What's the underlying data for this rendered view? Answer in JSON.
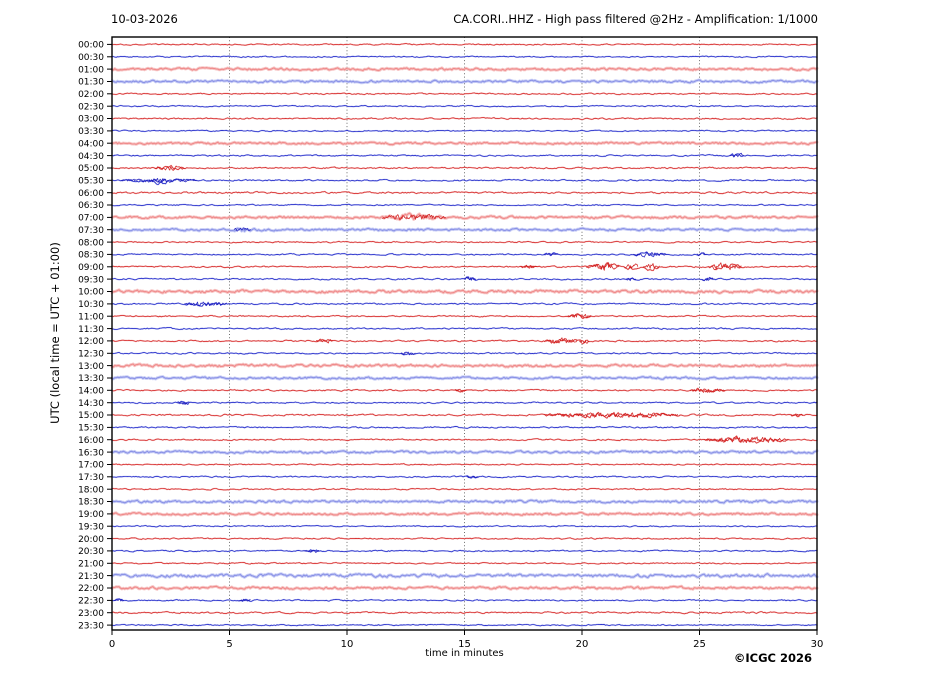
{
  "chart_data": {
    "type": "line",
    "subtype": "helicorder-seismogram-dayplot",
    "title_left": "10-03-2026",
    "title_right": "CA.CORI..HHZ - High pass filtered @2Hz - Amplification: 1/1000",
    "station": "CA.CORI..HHZ",
    "filter": "High pass filtered @2Hz",
    "amplification": "1/1000",
    "date": "10-03-2026",
    "xlabel": "time in minutes",
    "ylabel": "UTC (local time = UTC + 01:00)",
    "copyright": "©ICGC 2026",
    "x_range": [
      0,
      30
    ],
    "x_ticks": [
      0,
      5,
      10,
      15,
      20,
      25,
      30
    ],
    "gridline_minutes": [
      5,
      10,
      15,
      20,
      25
    ],
    "minutes_per_line": 30,
    "grid_on": true,
    "colors": {
      "red_center": "#d83232",
      "red_halo": "#f2b0b0",
      "red_light_center": "#ef8a8a",
      "red_light_halo": "#f6bcbc",
      "red_event": "#cf1616",
      "blue_center": "#2a32cc",
      "blue_halo": "#b0b6f0",
      "blue_light_center": "#8a92e6",
      "blue_light_halo": "#c0c6f4",
      "blue_event": "#1616bb",
      "grid": "#4a4a4a",
      "frame": "#000000"
    },
    "rows": [
      {
        "t": "00:00",
        "c": "red",
        "amp": 0.5,
        "light": false,
        "events": []
      },
      {
        "t": "00:30",
        "c": "blue",
        "amp": 0.5,
        "light": false,
        "events": []
      },
      {
        "t": "01:00",
        "c": "red",
        "amp": 0.9,
        "light": true,
        "events": []
      },
      {
        "t": "01:30",
        "c": "blue",
        "amp": 0.9,
        "light": true,
        "events": []
      },
      {
        "t": "02:00",
        "c": "red",
        "amp": 0.55,
        "light": false,
        "events": []
      },
      {
        "t": "02:30",
        "c": "blue",
        "amp": 0.5,
        "light": false,
        "events": []
      },
      {
        "t": "03:00",
        "c": "red",
        "amp": 0.6,
        "light": false,
        "events": []
      },
      {
        "t": "03:30",
        "c": "blue",
        "amp": 0.5,
        "light": false,
        "events": []
      },
      {
        "t": "04:00",
        "c": "red",
        "amp": 0.85,
        "light": true,
        "events": []
      },
      {
        "t": "04:30",
        "c": "blue",
        "amp": 0.55,
        "light": false,
        "events": [
          [
            26.3,
            26.9,
            1.4
          ]
        ]
      },
      {
        "t": "05:00",
        "c": "red",
        "amp": 0.6,
        "light": false,
        "events": [
          [
            1.8,
            3.1,
            1.2
          ]
        ]
      },
      {
        "t": "05:30",
        "c": "blue",
        "amp": 0.6,
        "light": false,
        "events": [
          [
            0.4,
            3.6,
            1.0
          ],
          [
            1.7,
            2.3,
            1.6
          ]
        ]
      },
      {
        "t": "06:00",
        "c": "red",
        "amp": 0.7,
        "light": false,
        "events": []
      },
      {
        "t": "06:30",
        "c": "blue",
        "amp": 0.5,
        "light": false,
        "events": []
      },
      {
        "t": "07:00",
        "c": "red",
        "amp": 0.9,
        "light": true,
        "events": [
          [
            11.5,
            14.2,
            1.6
          ]
        ]
      },
      {
        "t": "07:30",
        "c": "blue",
        "amp": 0.85,
        "light": true,
        "events": [
          [
            5.2,
            5.9,
            1.1
          ]
        ]
      },
      {
        "t": "08:00",
        "c": "red",
        "amp": 0.55,
        "light": false,
        "events": []
      },
      {
        "t": "08:30",
        "c": "blue",
        "amp": 0.55,
        "light": false,
        "events": [
          [
            18.4,
            19.0,
            0.9
          ],
          [
            22.2,
            23.6,
            1.4
          ],
          [
            24.9,
            25.3,
            0.9
          ]
        ]
      },
      {
        "t": "09:00",
        "c": "red",
        "amp": 0.6,
        "light": false,
        "events": [
          [
            17.4,
            18.1,
            0.9
          ],
          [
            20.2,
            21.6,
            2.2
          ],
          [
            21.8,
            22.4,
            2.0
          ],
          [
            22.6,
            23.3,
            2.2
          ],
          [
            25.4,
            26.8,
            2.2
          ]
        ]
      },
      {
        "t": "09:30",
        "c": "blue",
        "amp": 0.6,
        "light": false,
        "events": [
          [
            15.0,
            15.5,
            1.7
          ],
          [
            21.9,
            22.3,
            0.9
          ],
          [
            25.1,
            25.6,
            1.1
          ]
        ]
      },
      {
        "t": "10:00",
        "c": "red",
        "amp": 1.1,
        "light": true,
        "events": []
      },
      {
        "t": "10:30",
        "c": "blue",
        "amp": 0.6,
        "light": false,
        "events": [
          [
            3.1,
            4.9,
            1.4
          ]
        ]
      },
      {
        "t": "11:00",
        "c": "red",
        "amp": 0.55,
        "light": false,
        "events": [
          [
            19.4,
            20.4,
            1.4
          ]
        ]
      },
      {
        "t": "11:30",
        "c": "blue",
        "amp": 0.6,
        "light": false,
        "events": []
      },
      {
        "t": "12:00",
        "c": "red",
        "amp": 0.6,
        "light": false,
        "events": [
          [
            8.7,
            9.4,
            1.4
          ],
          [
            18.4,
            19.8,
            1.6
          ],
          [
            19.9,
            20.3,
            2.4
          ]
        ]
      },
      {
        "t": "12:30",
        "c": "blue",
        "amp": 0.55,
        "light": false,
        "events": [
          [
            12.3,
            12.9,
            1.1
          ]
        ]
      },
      {
        "t": "13:00",
        "c": "red",
        "amp": 1.0,
        "light": true,
        "events": []
      },
      {
        "t": "13:30",
        "c": "blue",
        "amp": 0.8,
        "light": true,
        "events": []
      },
      {
        "t": "14:00",
        "c": "red",
        "amp": 0.6,
        "light": false,
        "events": [
          [
            14.6,
            15.1,
            1.1
          ],
          [
            24.6,
            26.1,
            1.2
          ]
        ]
      },
      {
        "t": "14:30",
        "c": "blue",
        "amp": 0.55,
        "light": false,
        "events": [
          [
            2.8,
            3.3,
            1.4
          ]
        ]
      },
      {
        "t": "15:00",
        "c": "red",
        "amp": 0.65,
        "light": false,
        "events": [
          [
            18.4,
            24.1,
            1.5
          ],
          [
            28.9,
            29.4,
            1.2
          ]
        ]
      },
      {
        "t": "15:30",
        "c": "blue",
        "amp": 0.6,
        "light": false,
        "events": []
      },
      {
        "t": "16:00",
        "c": "red",
        "amp": 0.6,
        "light": false,
        "events": [
          [
            25.2,
            28.8,
            2.0
          ]
        ]
      },
      {
        "t": "16:30",
        "c": "blue",
        "amp": 0.9,
        "light": true,
        "events": []
      },
      {
        "t": "17:00",
        "c": "red",
        "amp": 0.5,
        "light": false,
        "events": []
      },
      {
        "t": "17:30",
        "c": "blue",
        "amp": 0.55,
        "light": false,
        "events": [
          [
            15.1,
            15.6,
            0.9
          ]
        ]
      },
      {
        "t": "18:00",
        "c": "red",
        "amp": 0.55,
        "light": false,
        "events": []
      },
      {
        "t": "18:30",
        "c": "blue",
        "amp": 1.0,
        "light": true,
        "events": []
      },
      {
        "t": "19:00",
        "c": "red",
        "amp": 0.85,
        "light": true,
        "events": []
      },
      {
        "t": "19:30",
        "c": "blue",
        "amp": 0.5,
        "light": false,
        "events": []
      },
      {
        "t": "20:00",
        "c": "red",
        "amp": 0.55,
        "light": false,
        "events": []
      },
      {
        "t": "20:30",
        "c": "blue",
        "amp": 0.55,
        "light": false,
        "events": [
          [
            8.2,
            8.8,
            1.1
          ]
        ]
      },
      {
        "t": "21:00",
        "c": "red",
        "amp": 0.5,
        "light": false,
        "events": []
      },
      {
        "t": "21:30",
        "c": "blue",
        "amp": 1.2,
        "light": true,
        "events": []
      },
      {
        "t": "22:00",
        "c": "red",
        "amp": 0.95,
        "light": true,
        "events": []
      },
      {
        "t": "22:30",
        "c": "blue",
        "amp": 0.55,
        "light": false,
        "events": [
          [
            0.1,
            0.5,
            0.9
          ],
          [
            5.4,
            5.9,
            0.8
          ]
        ]
      },
      {
        "t": "23:00",
        "c": "red",
        "amp": 0.65,
        "light": false,
        "events": []
      },
      {
        "t": "23:30",
        "c": "blue",
        "amp": 0.5,
        "light": false,
        "events": []
      }
    ]
  }
}
